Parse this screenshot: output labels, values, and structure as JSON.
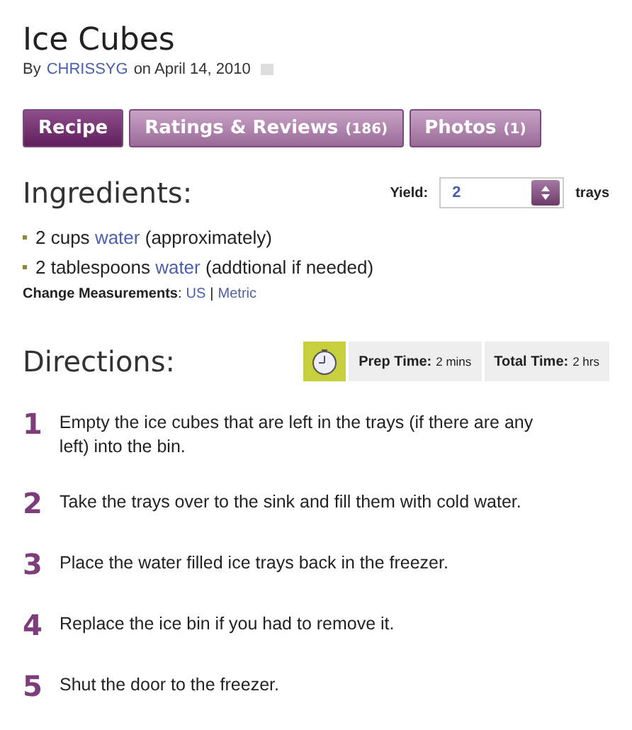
{
  "title": "Ice Cubes",
  "byline": {
    "prefix": "By",
    "author": "CHRISSYG",
    "date": "on April 14, 2010"
  },
  "tabs": [
    {
      "label": "Recipe",
      "selected": true
    },
    {
      "label": "Ratings & Reviews",
      "count": "(186)",
      "selected": false
    },
    {
      "label": "Photos",
      "count": "(1)",
      "selected": false
    }
  ],
  "ingredients": {
    "heading": "Ingredients:",
    "yield": {
      "label": "Yield:",
      "value": "2",
      "unit": "trays"
    },
    "items": [
      {
        "amount": "2 cups",
        "name": "water",
        "note": "(approximately)"
      },
      {
        "amount": "2 tablespoons",
        "name": "water",
        "note": "(addtional if needed)"
      }
    ],
    "measurements": {
      "label": "Change Measurements",
      "colon": ":",
      "options": [
        "US",
        "Metric"
      ],
      "separator": "|"
    }
  },
  "directions": {
    "heading": "Directions:",
    "times": [
      {
        "label": "Prep Time:",
        "value": "2 mins"
      },
      {
        "label": "Total Time:",
        "value": "2 hrs"
      }
    ],
    "steps": [
      {
        "number": "1",
        "text": "Empty the ice cubes that are left in the trays (if there are any left) into the bin."
      },
      {
        "number": "2",
        "text": "Take the trays over to the sink and fill them with cold water."
      },
      {
        "number": "3",
        "text": "Place the water filled ice trays back in the freezer."
      },
      {
        "number": "4",
        "text": "Replace the ice bin if you had to remove it."
      },
      {
        "number": "5",
        "text": "Shut the door to the freezer."
      }
    ]
  }
}
